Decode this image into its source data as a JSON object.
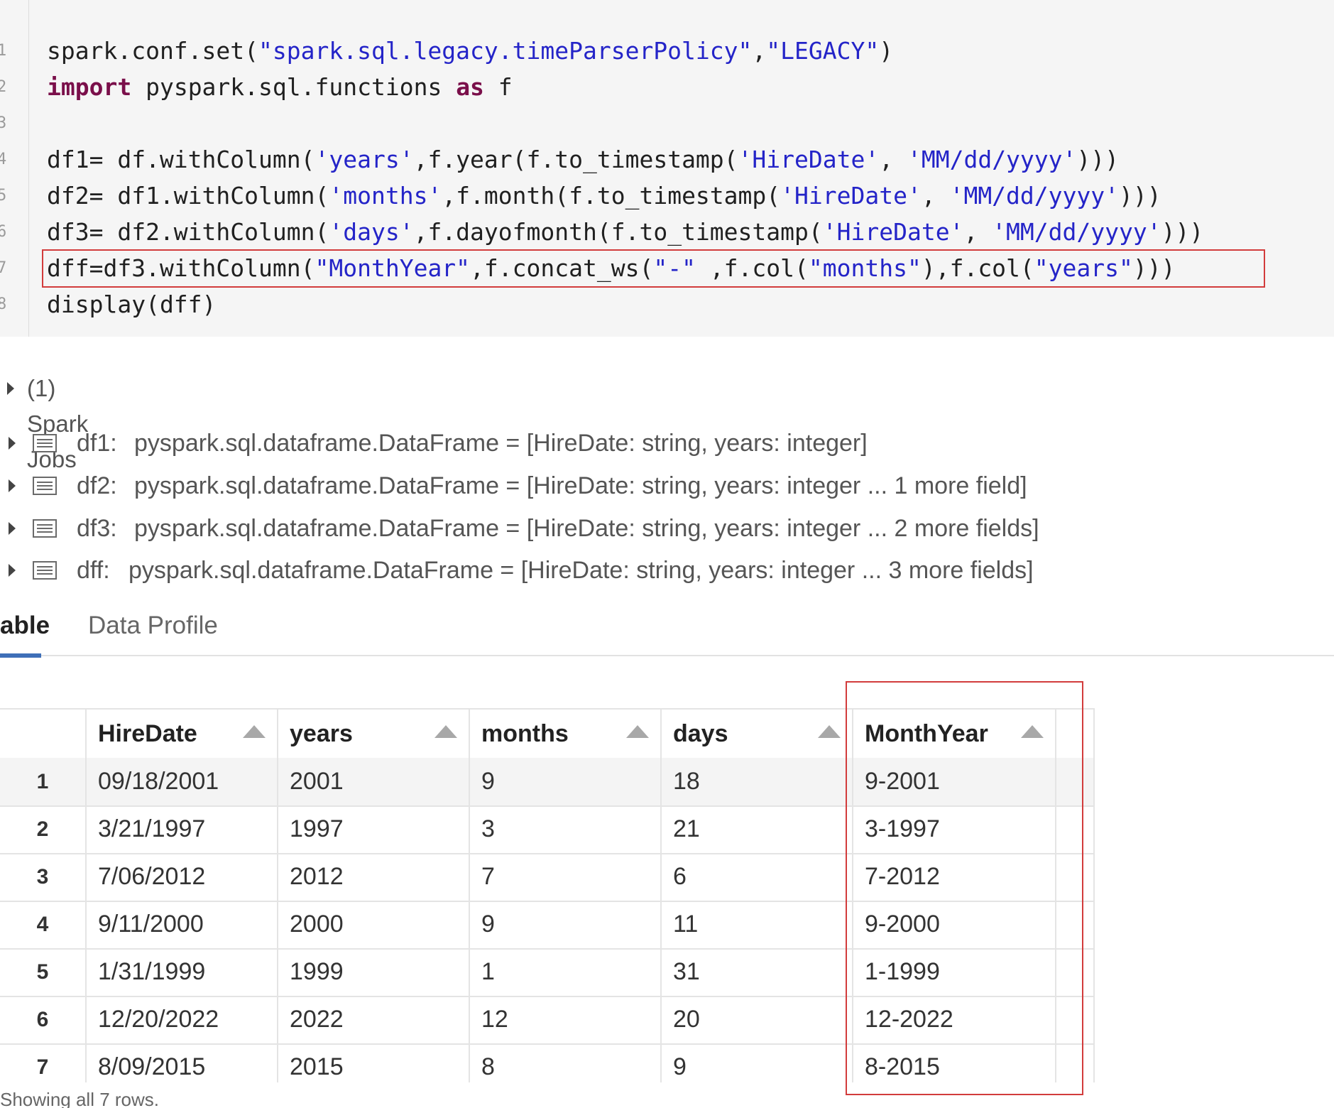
{
  "code": {
    "line_numbers": [
      "1",
      "2",
      "3",
      "4",
      "5",
      "6",
      "7",
      "8"
    ],
    "lines": [
      [
        [
          "t",
          "spark.conf.set("
        ],
        [
          "s",
          "\"spark.sql.legacy.timeParserPolicy\""
        ],
        [
          "t",
          ","
        ],
        [
          "s",
          "\"LEGACY\""
        ],
        [
          "t",
          ")"
        ]
      ],
      [
        [
          "k",
          "import"
        ],
        [
          "t",
          " pyspark.sql.functions "
        ],
        [
          "k",
          "as"
        ],
        [
          "t",
          " f"
        ]
      ],
      [],
      [
        [
          "t",
          "df1= df.withColumn("
        ],
        [
          "s",
          "'years'"
        ],
        [
          "t",
          ",f.year(f.to_timestamp("
        ],
        [
          "s",
          "'HireDate'"
        ],
        [
          "t",
          ", "
        ],
        [
          "s",
          "'MM/dd/yyyy'"
        ],
        [
          "t",
          ")))"
        ]
      ],
      [
        [
          "t",
          "df2= df1.withColumn("
        ],
        [
          "s",
          "'months'"
        ],
        [
          "t",
          ",f.month(f.to_timestamp("
        ],
        [
          "s",
          "'HireDate'"
        ],
        [
          "t",
          ", "
        ],
        [
          "s",
          "'MM/dd/yyyy'"
        ],
        [
          "t",
          ")))"
        ]
      ],
      [
        [
          "t",
          "df3= df2.withColumn("
        ],
        [
          "s",
          "'days'"
        ],
        [
          "t",
          ",f.dayofmonth(f.to_timestamp("
        ],
        [
          "s",
          "'HireDate'"
        ],
        [
          "t",
          ", "
        ],
        [
          "s",
          "'MM/dd/yyyy'"
        ],
        [
          "t",
          ")))"
        ]
      ],
      [
        [
          "t",
          "dff=df3.withColumn("
        ],
        [
          "s",
          "\"MonthYear\""
        ],
        [
          "t",
          ",f.concat_ws("
        ],
        [
          "s",
          "\"-\""
        ],
        [
          "t",
          " ,f.col("
        ],
        [
          "s",
          "\"months\""
        ],
        [
          "t",
          "),f.col("
        ],
        [
          "s",
          "\"years\""
        ],
        [
          "t",
          ")))"
        ]
      ],
      [
        [
          "t",
          "display(dff)"
        ]
      ]
    ]
  },
  "jobs": {
    "label": "(1) Spark Jobs"
  },
  "dataframes": [
    {
      "name": "df1:",
      "desc": "pyspark.sql.dataframe.DataFrame = [HireDate: string, years: integer]"
    },
    {
      "name": "df2:",
      "desc": "pyspark.sql.dataframe.DataFrame = [HireDate: string, years: integer ... 1 more field]"
    },
    {
      "name": "df3:",
      "desc": "pyspark.sql.dataframe.DataFrame = [HireDate: string, years: integer ... 2 more fields]"
    },
    {
      "name": "dff:",
      "desc": "pyspark.sql.dataframe.DataFrame = [HireDate: string, years: integer ... 3 more fields]"
    }
  ],
  "tabs": {
    "table": "able",
    "profile": "Data Profile"
  },
  "table": {
    "columns": [
      "HireDate",
      "years",
      "months",
      "days",
      "MonthYear"
    ],
    "rows": [
      [
        "1",
        "09/18/2001",
        "2001",
        "9",
        "18",
        "9-2001"
      ],
      [
        "2",
        "3/21/1997",
        "1997",
        "3",
        "21",
        "3-1997"
      ],
      [
        "3",
        "7/06/2012",
        "2012",
        "7",
        "6",
        "7-2012"
      ],
      [
        "4",
        "9/11/2000",
        "2000",
        "9",
        "11",
        "9-2000"
      ],
      [
        "5",
        "1/31/1999",
        "1999",
        "1",
        "31",
        "1-1999"
      ],
      [
        "6",
        "12/20/2022",
        "2022",
        "12",
        "20",
        "12-2022"
      ],
      [
        "7",
        "8/09/2015",
        "2015",
        "8",
        "9",
        "8-2015"
      ]
    ]
  },
  "footer": {
    "text": "Showing all 7 rows."
  },
  "colors": {
    "highlight": "#d23c3c",
    "string": "#2424c8",
    "keyword": "#7a0f4a",
    "tab_accent": "#3f6fb8"
  }
}
